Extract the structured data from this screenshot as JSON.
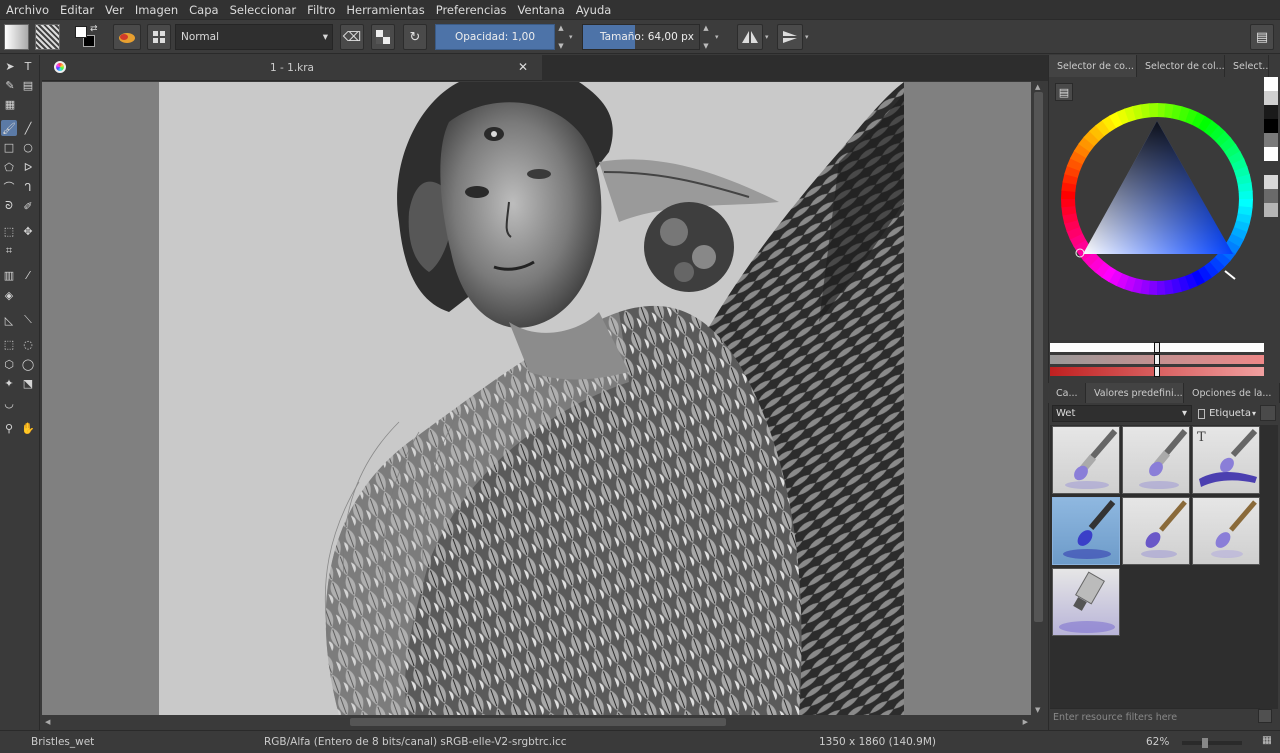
{
  "menu": [
    "Archivo",
    "Editar",
    "Ver",
    "Imagen",
    "Capa",
    "Seleccionar",
    "Filtro",
    "Herramientas",
    "Preferencias",
    "Ventana",
    "Ayuda"
  ],
  "toolbar": {
    "blend_mode": "Normal",
    "opacity_label": "Opacidad:",
    "opacity_value": "1,00",
    "size_label": "Tamaño:",
    "size_value": "64,00 px",
    "size_fill": 0.45
  },
  "document": {
    "tab_title": "1 - 1.kra"
  },
  "docker": {
    "color_tabs": [
      "Selector de co...",
      "Selector de col...",
      "Select..."
    ],
    "brush_tabs": [
      "Ca...",
      "Valores predefini...",
      "Opciones de la..."
    ],
    "preset_filter": "Wet",
    "tag_label": "Etiqueta",
    "filter_placeholder": "Enter resource filters here",
    "hue_ring_colors": [
      "#ff0000",
      "#ffff00",
      "#00ff00",
      "#00ffff",
      "#0000ff",
      "#ff00ff"
    ],
    "swatches": [
      "#ffffff",
      "#d0d0d0",
      "#1a1a1a",
      "#000000",
      "#7a7a7a",
      "#ffffff",
      "#3a3a3a",
      "#d8d8d8",
      "#6a6a6a",
      "#b5b5b5"
    ]
  },
  "status": {
    "preset": "Bristles_wet",
    "colorspace": "RGB/Alfa (Entero de 8 bits/canal)  sRGB-elle-V2-srgbtrc.icc",
    "dimensions": "1350 x 1860 (140.9M)",
    "zoom": "62%"
  }
}
